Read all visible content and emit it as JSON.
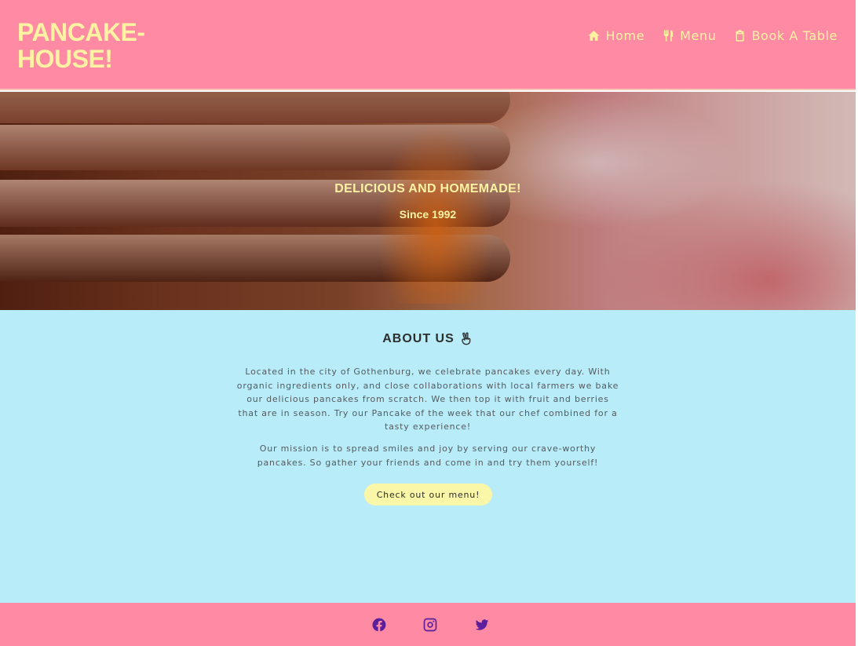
{
  "header": {
    "logo_line1": "PANCAKE-",
    "logo_line2": "HOUSE!",
    "nav": [
      {
        "label": "Home",
        "icon": "home-icon"
      },
      {
        "label": "Menu",
        "icon": "utensils-icon"
      },
      {
        "label": "Book A Table",
        "icon": "clipboard-icon"
      }
    ]
  },
  "hero": {
    "title": "DELICIOUS AND HOMEMADE!",
    "subtitle": "Since 1992"
  },
  "about": {
    "title": "ABOUT US",
    "title_icon": "peace-hand-icon",
    "paragraph1": "Located in the city of Gothenburg, we celebrate pancakes every day. With organic ingredients only, and close collaborations with local farmers we bake our delicious pancakes from scratch. We then top it with fruit and berries that are in season. Try our Pancake of the week that our chef combined for a tasty experience!",
    "paragraph2": "Our mission is to spread smiles and joy by serving our crave-worthy pancakes. So gather your friends and come in and try them yourself!",
    "button_label": "Check out our menu!"
  },
  "footer": {
    "social": [
      "facebook-icon",
      "instagram-icon",
      "twitter-icon"
    ]
  },
  "colors": {
    "header_bg": "#ff8aa3",
    "accent_yellow": "#fff3a3",
    "about_bg": "#b8ecf8",
    "button_bg": "#fbf7a8",
    "social_icon": "#5b1f9e"
  }
}
